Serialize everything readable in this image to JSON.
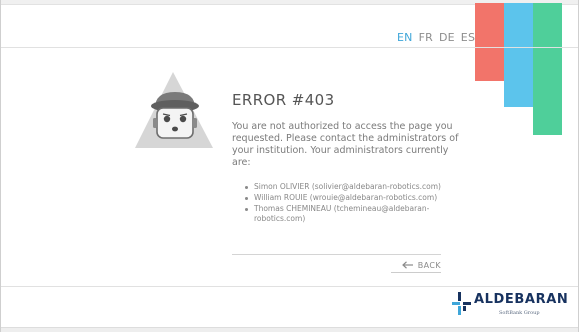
{
  "languages": {
    "en": "EN",
    "fr": "FR",
    "de": "DE",
    "es": "ES",
    "active": "EN"
  },
  "colors": {
    "accent_blue": "#3fa6d9",
    "bar_red": "#f2746a",
    "bar_blue": "#5cc4ec",
    "bar_green": "#4fcf9a",
    "logo_navy": "#17325f"
  },
  "illustration": {
    "icon": "sad-robot-icon"
  },
  "error": {
    "title": "ERROR #403",
    "message": "You are not authorized to access the page you requested. Please contact the administrators of your institution. Your administrators currently are:",
    "administrators": [
      "Simon OLIVIER (solivier@aldebaran-robotics.com)",
      "William ROUIE (wrouie@aldebaran-robotics.com)",
      "Thomas CHEMINEAU (tchemineau@aldebaran-robotics.com)"
    ]
  },
  "back": {
    "label": "BACK",
    "icon": "arrow-left-icon"
  },
  "footer": {
    "logo_text": "ALDEBARAN",
    "logo_subtext": "SoftBank Group"
  }
}
